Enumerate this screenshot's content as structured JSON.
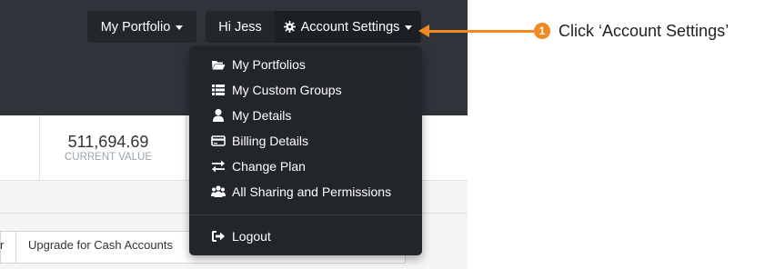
{
  "header": {
    "portfolio_label": "My Portfolio",
    "greeting": "Hi Jess",
    "settings_label": "Account Settings"
  },
  "stats": {
    "current_value": "511,694.69",
    "current_value_label": "CURRENT VALUE"
  },
  "tabs": {
    "prev_partial": "r",
    "upgrade_label": "Upgrade for Cash Accounts"
  },
  "dropdown": {
    "items": [
      {
        "label": "My Portfolios",
        "icon": "folder-open-icon"
      },
      {
        "label": "My Custom Groups",
        "icon": "list-icon"
      },
      {
        "label": "My Details",
        "icon": "user-icon"
      },
      {
        "label": "Billing Details",
        "icon": "credit-card-icon"
      },
      {
        "label": "Change Plan",
        "icon": "exchange-icon"
      },
      {
        "label": "All Sharing and Permissions",
        "icon": "users-icon"
      }
    ],
    "logout": {
      "label": "Logout",
      "icon": "sign-out-icon"
    }
  },
  "callout": {
    "number": "1",
    "text": "Click ‘Account Settings’",
    "color": "#f08a24"
  }
}
